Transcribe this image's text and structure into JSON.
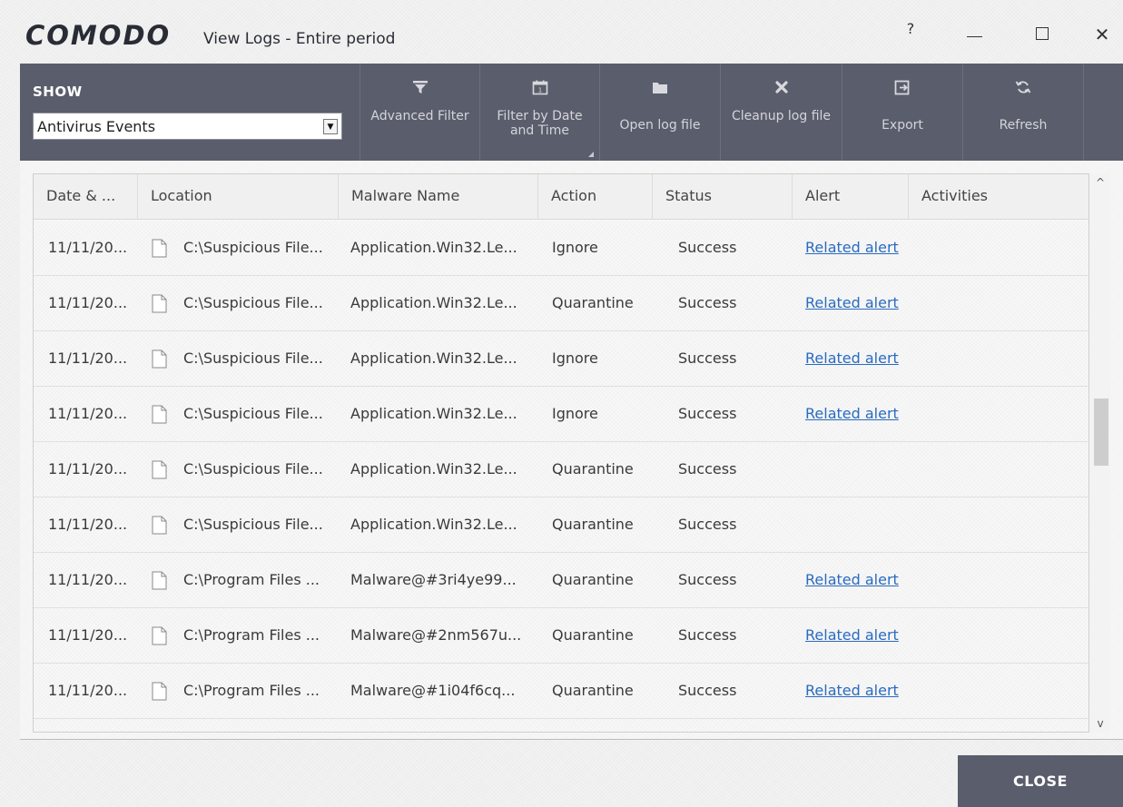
{
  "window": {
    "logo": "COMODO",
    "title": "View Logs - Entire period",
    "help_label": "?",
    "close_label": "✕"
  },
  "toolbar": {
    "show_label": "SHOW",
    "show_selected": "Antivirus Events",
    "buttons": [
      {
        "icon": "filter-icon",
        "label": "Advanced Filter"
      },
      {
        "icon": "calendar-icon",
        "label": "Filter by Date and Time"
      },
      {
        "icon": "folder-icon",
        "label": "Open log file"
      },
      {
        "icon": "cross-icon",
        "label": "Cleanup log file"
      },
      {
        "icon": "export-icon",
        "label": "Export"
      },
      {
        "icon": "refresh-icon",
        "label": "Refresh"
      }
    ]
  },
  "table": {
    "columns": [
      "Date & ...",
      "Location",
      "Malware Name",
      "Action",
      "Status",
      "Alert",
      "Activities"
    ],
    "rows": [
      {
        "date": "11/11/20...",
        "location": "C:\\Suspicious File...",
        "malware": "Application.Win32.Le...",
        "action": "Ignore",
        "status": "Success",
        "alert": "Related alert",
        "activities": ""
      },
      {
        "date": "11/11/20...",
        "location": "C:\\Suspicious File...",
        "malware": "Application.Win32.Le...",
        "action": "Quarantine",
        "status": "Success",
        "alert": "Related alert",
        "activities": ""
      },
      {
        "date": "11/11/20...",
        "location": "C:\\Suspicious File...",
        "malware": "Application.Win32.Le...",
        "action": "Ignore",
        "status": "Success",
        "alert": "Related alert",
        "activities": ""
      },
      {
        "date": "11/11/20...",
        "location": "C:\\Suspicious File...",
        "malware": "Application.Win32.Le...",
        "action": "Ignore",
        "status": "Success",
        "alert": "Related alert",
        "activities": ""
      },
      {
        "date": "11/11/20...",
        "location": "C:\\Suspicious File...",
        "malware": "Application.Win32.Le...",
        "action": "Quarantine",
        "status": "Success",
        "alert": "",
        "activities": ""
      },
      {
        "date": "11/11/20...",
        "location": "C:\\Suspicious File...",
        "malware": "Application.Win32.Le...",
        "action": "Quarantine",
        "status": "Success",
        "alert": "",
        "activities": ""
      },
      {
        "date": "11/11/20...",
        "location": "C:\\Program Files ...",
        "malware": "Malware@#3ri4ye99...",
        "action": "Quarantine",
        "status": "Success",
        "alert": "Related alert",
        "activities": ""
      },
      {
        "date": "11/11/20...",
        "location": "C:\\Program Files ...",
        "malware": "Malware@#2nm567u...",
        "action": "Quarantine",
        "status": "Success",
        "alert": "Related alert",
        "activities": ""
      },
      {
        "date": "11/11/20...",
        "location": "C:\\Program Files ...",
        "malware": "Malware@#1i04f6cq...",
        "action": "Quarantine",
        "status": "Success",
        "alert": "Related alert",
        "activities": ""
      }
    ]
  },
  "close_button": "CLOSE",
  "colors": {
    "toolbar_bg": "#5a5d6b",
    "link": "#2a6bbf",
    "close_bg": "#5a5d6b"
  }
}
